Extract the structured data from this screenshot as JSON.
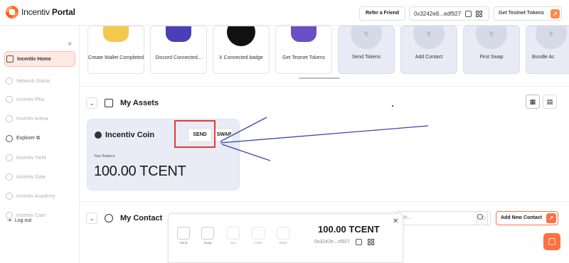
{
  "app": {
    "logo_prefix": "Incentiv",
    "logo_bold": "Portal"
  },
  "header": {
    "refer_label": "Refer a Friend",
    "address": "0x3242e8...edf927",
    "testnet_label": "Get Testnet Tokens"
  },
  "sidebar": {
    "collapse": "«",
    "items": [
      {
        "label": "Incentiv Home",
        "icon": "home-icon"
      },
      {
        "label": "Network Status",
        "icon": "network-icon"
      },
      {
        "label": "Incentiv Plus",
        "icon": "plus-icon"
      },
      {
        "label": "Incentiv Arena",
        "icon": "arena-icon"
      },
      {
        "label": "Explorer ⧉",
        "icon": "explorer-icon"
      },
      {
        "label": "Incentiv Yield",
        "icon": "yield-icon"
      },
      {
        "label": "Incentiv Gate",
        "icon": "gate-icon"
      },
      {
        "label": "Incentiv Academy",
        "icon": "academy-icon"
      },
      {
        "label": "Incentiv Care",
        "icon": "care-icon"
      }
    ],
    "logout": "Log out"
  },
  "cards": [
    {
      "label": "Create Wallet Completed",
      "color": "#f2c94c"
    },
    {
      "label": "Discord Connected...",
      "color": "#4a3fb5"
    },
    {
      "label": "X Connected badge",
      "color": "#111111"
    },
    {
      "label": "Get Testnet Tokens",
      "color": "#6b4fc7"
    },
    {
      "label": "Send Tokens"
    },
    {
      "label": "Add Contact"
    },
    {
      "label": "First Swap"
    },
    {
      "label": "Bundle Ac"
    }
  ],
  "assets": {
    "title": "My Assets",
    "coin_name": "Incentiv Coin",
    "send_label": "SEND",
    "swap_label": "SWAP",
    "balance_label": "Your Balance",
    "balance_value": "100.00 TCENT"
  },
  "contacts": {
    "title": "My Contact",
    "search_placeholder": "rch...",
    "add_label": "Add New Contact"
  },
  "popup": {
    "actions": [
      "Send",
      "Swap",
      "Buy",
      "Claim",
      "Stake"
    ],
    "balance": "100.00 TCENT",
    "address": "0x3242e...cf927",
    "close": "✕"
  },
  "colors": {
    "accent": "#ff7043",
    "annotation": "#e53935",
    "arrow": "#3949ab"
  }
}
